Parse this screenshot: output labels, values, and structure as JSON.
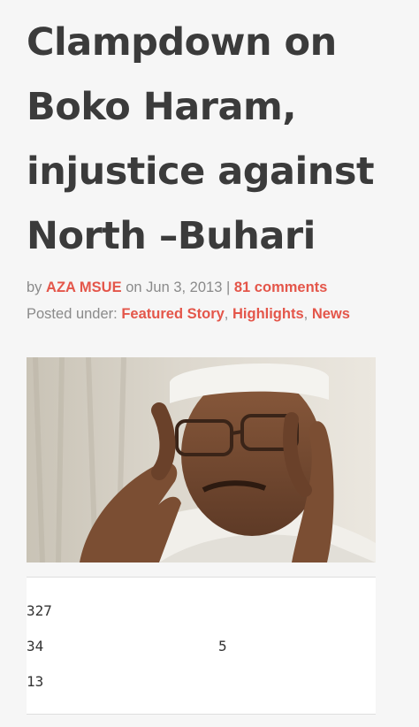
{
  "article": {
    "title": "Clampdown on Boko Haram, injustice against North –Buhari",
    "byline": {
      "prefix": "by",
      "author": "AZA MSUE",
      "on_label": "on",
      "date": "Jun 3, 2013",
      "separator": "|",
      "comments": "81 comments"
    },
    "posted_under": {
      "label": "Posted under:",
      "categories": [
        "Featured Story",
        "Highlights",
        "News"
      ]
    },
    "photo": {
      "icon": "portrait-photo"
    }
  },
  "share_counts": {
    "count_1": "327",
    "count_2": "34",
    "count_3": "5",
    "count_4": "13"
  },
  "colors": {
    "accent": "#e4564a",
    "title": "#3b3b3b",
    "meta": "#8a8a8a",
    "background": "#f6f6f6"
  }
}
